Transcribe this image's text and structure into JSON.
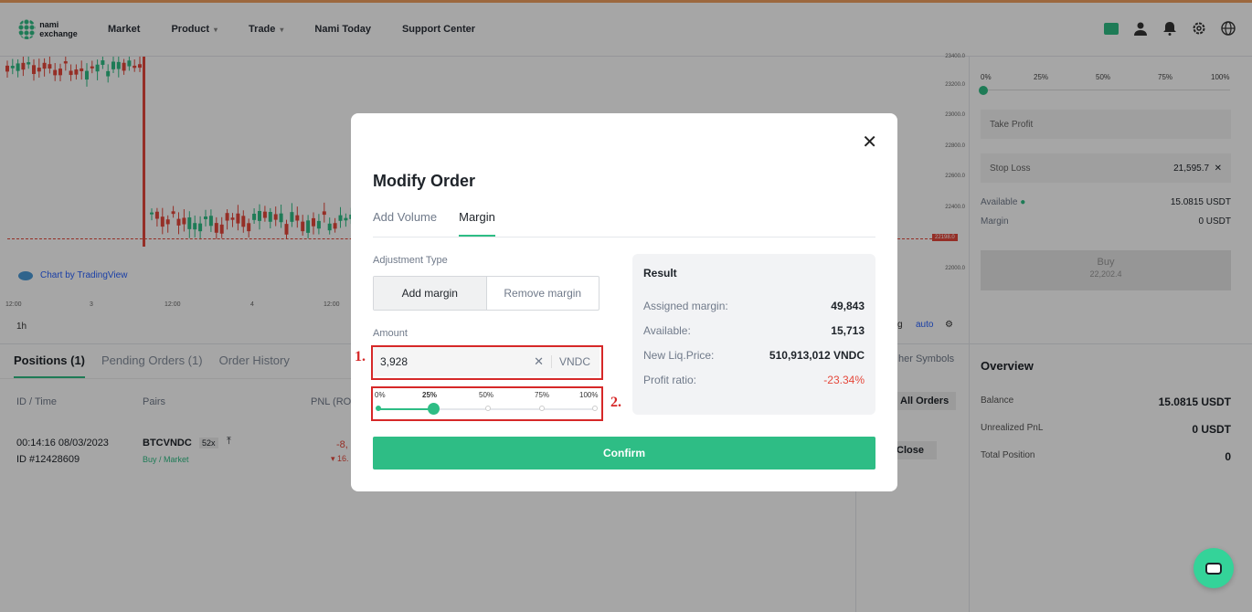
{
  "header": {
    "logo": "nami exchange",
    "nav": [
      {
        "label": "Market",
        "dropdown": false
      },
      {
        "label": "Product",
        "dropdown": true
      },
      {
        "label": "Trade",
        "dropdown": true
      },
      {
        "label": "Nami Today",
        "dropdown": false
      },
      {
        "label": "Support Center",
        "dropdown": false
      }
    ],
    "icons": [
      "wallet-icon",
      "user-icon",
      "bell-icon",
      "gear-icon",
      "globe-icon"
    ]
  },
  "chart": {
    "price_ticks": [
      "23400.0",
      "23200.0",
      "23000.0",
      "22800.0",
      "22600.0",
      "22400.0",
      "22200.0",
      "22000.0"
    ],
    "current_price": "22198.0",
    "credit": "Chart by TradingView",
    "time_ticks": [
      "12:00",
      "3",
      "12:00",
      "4",
      "12:00"
    ],
    "interval": "1h",
    "controls": {
      "log": "g",
      "auto": "auto"
    }
  },
  "positions": {
    "tabs": [
      {
        "label": "Positions  (1)",
        "active": true
      },
      {
        "label": "Pending Orders  (1)",
        "active": false
      },
      {
        "label": "Order History",
        "active": false
      }
    ],
    "headers": {
      "id_time": "ID / Time",
      "pairs": "Pairs",
      "pnl": "PNL (RO"
    },
    "row": {
      "time": "00:14:16 08/03/2023",
      "id": "ID #12428609",
      "pair": "BTCVNDC",
      "leverage": "52x",
      "side": "Buy / Market",
      "pnl": "-8,",
      "pnl_pct": "16."
    }
  },
  "middle_panel": {
    "other_symbols": "her Symbols",
    "all_orders": "All Orders",
    "close": "Close"
  },
  "order_panel": {
    "slider_labels": [
      "0%",
      "25%",
      "50%",
      "75%",
      "100%"
    ],
    "take_profit": "Take Profit",
    "stop_loss": {
      "label": "Stop Loss",
      "value": "21,595.7"
    },
    "available": {
      "label": "Available",
      "value": "15.0815 USDT"
    },
    "margin": {
      "label": "Margin",
      "value": "0 USDT"
    },
    "buy": {
      "label": "Buy",
      "price": "22,202.4"
    }
  },
  "overview": {
    "title": "Overview",
    "rows": [
      {
        "label": "Balance",
        "value": "15.0815 USDT"
      },
      {
        "label": "Unrealized PnL",
        "value": "0 USDT"
      },
      {
        "label": "Total Position",
        "value": "0"
      }
    ]
  },
  "modal": {
    "title": "Modify Order",
    "tabs": [
      {
        "label": "Add Volume",
        "active": false
      },
      {
        "label": "Margin",
        "active": true
      }
    ],
    "adjustment_type_label": "Adjustment Type",
    "add_margin": "Add margin",
    "remove_margin": "Remove margin",
    "amount_label": "Amount",
    "amount_value": "3,928",
    "amount_unit": "VNDC",
    "slider": {
      "labels": [
        "0%",
        "25%",
        "50%",
        "75%",
        "100%"
      ],
      "value_pct": 25
    },
    "annotations": [
      "1.",
      "2."
    ],
    "result": {
      "title": "Result",
      "rows": [
        {
          "label": "Assigned margin:",
          "value": "49,843"
        },
        {
          "label": "Available:",
          "value": "15,713"
        },
        {
          "label": "New Liq.Price:",
          "value": "510,913,012 VNDC"
        },
        {
          "label": "Profit ratio:",
          "value": "-23.34%"
        }
      ]
    },
    "confirm": "Confirm"
  },
  "colors": {
    "accent": "#2ebd85",
    "negative": "#e5483b",
    "annotation": "#d62828"
  }
}
